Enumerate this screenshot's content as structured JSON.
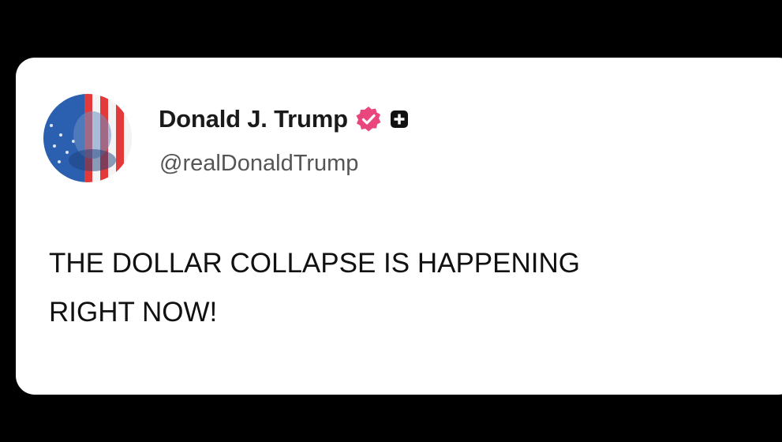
{
  "post": {
    "author": {
      "display_name": "Donald J. Trump",
      "handle": "@realDonaldTrump",
      "avatar": "flag-portrait-avatar",
      "verified_icon": "verified-badge-icon",
      "verified_color": "#e8467c",
      "extra_badge_icon": "plus-badge-icon"
    },
    "text": "THE DOLLAR COLLAPSE IS HAPPENING\nRIGHT NOW!"
  },
  "colors": {
    "background": "#000000",
    "card": "#ffffff",
    "name": "#1a1a1a",
    "handle": "#555555",
    "body_text": "#111111"
  }
}
